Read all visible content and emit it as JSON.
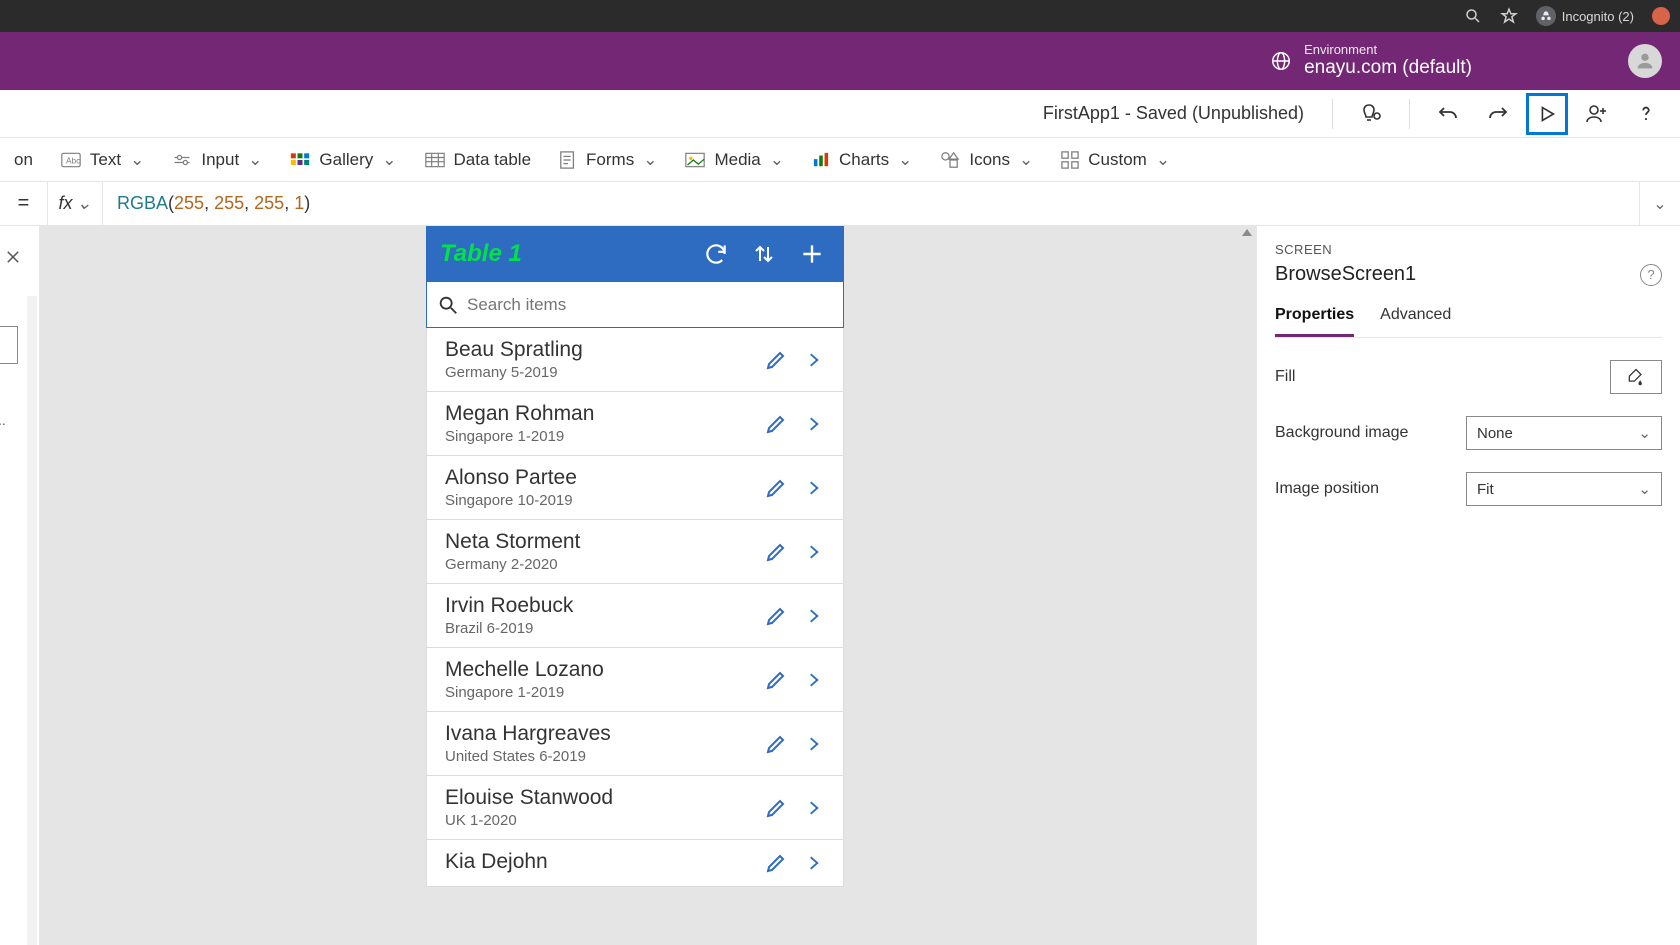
{
  "browser": {
    "incognito_label": "Incognito (2)"
  },
  "environment": {
    "label": "Environment",
    "value": "enayu.com (default)"
  },
  "title_bar": {
    "status": "FirstApp1 - Saved (Unpublished)"
  },
  "ribbon": {
    "left_fragment": "on",
    "text": "Text",
    "input": "Input",
    "gallery": "Gallery",
    "data_table": "Data table",
    "forms": "Forms",
    "media": "Media",
    "charts": "Charts",
    "icons": "Icons",
    "custom": "Custom"
  },
  "formula": {
    "eq": "=",
    "fx": "fx",
    "fn": "RGBA",
    "args": [
      "255",
      "255",
      "255",
      "1"
    ]
  },
  "canvas": {
    "app_title": "Table 1",
    "search_placeholder": "Search items",
    "rows": [
      {
        "name": "Beau Spratling",
        "sub": "Germany 5-2019"
      },
      {
        "name": "Megan Rohman",
        "sub": "Singapore 1-2019"
      },
      {
        "name": "Alonso Partee",
        "sub": "Singapore 10-2019"
      },
      {
        "name": "Neta Storment",
        "sub": "Germany 2-2020"
      },
      {
        "name": "Irvin Roebuck",
        "sub": "Brazil 6-2019"
      },
      {
        "name": "Mechelle Lozano",
        "sub": "Singapore 1-2019"
      },
      {
        "name": "Ivana Hargreaves",
        "sub": "United States 6-2019"
      },
      {
        "name": "Elouise Stanwood",
        "sub": "UK 1-2020"
      },
      {
        "name": "Kia Dejohn",
        "sub": ""
      }
    ]
  },
  "properties": {
    "section": "SCREEN",
    "screen_name": "BrowseScreen1",
    "tabs": {
      "properties": "Properties",
      "advanced": "Advanced"
    },
    "fill_label": "Fill",
    "bg_image_label": "Background image",
    "bg_image_value": "None",
    "img_pos_label": "Image position",
    "img_pos_value": "Fit"
  }
}
